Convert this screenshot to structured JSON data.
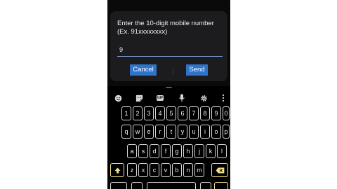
{
  "dialog": {
    "title": "Enter the 10-digit mobile number (Ex. 91xxxxxxxx)",
    "input_value": "9",
    "cancel_label": "Cancel",
    "send_label": "Send"
  },
  "toolbar": {
    "icons": [
      "emoji-icon",
      "sticker-icon",
      "gif-icon",
      "microphone-icon",
      "settings-icon",
      "more-icon"
    ],
    "gif_label": "GIF"
  },
  "keyboard": {
    "row1": [
      "1",
      "2",
      "3",
      "4",
      "5",
      "6",
      "7",
      "8",
      "9",
      "0"
    ],
    "row2": [
      "q",
      "w",
      "e",
      "r",
      "t",
      "y",
      "u",
      "i",
      "o",
      "p"
    ],
    "row3": [
      "a",
      "s",
      "d",
      "f",
      "g",
      "h",
      "j",
      "k",
      "l"
    ],
    "row4": [
      "z",
      "x",
      "c",
      "v",
      "b",
      "n",
      "m"
    ]
  },
  "colors": {
    "accent_button": "#2f74c8",
    "key_border": "#d8d8d8",
    "special_key": "#f1e08a"
  }
}
